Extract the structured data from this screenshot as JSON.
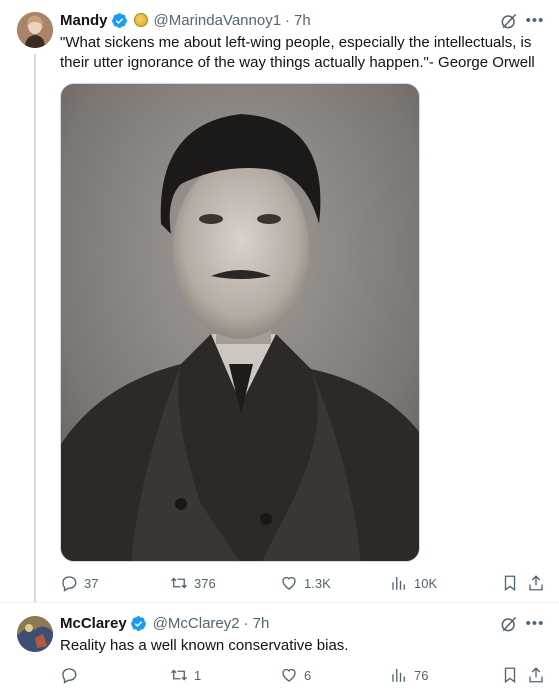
{
  "tweets": [
    {
      "author": {
        "name": "Mandy",
        "handle": "@MarindaVannoy1",
        "time": "7h"
      },
      "text": "\"What sickens me about left-wing people, especially the intellectuals, is their utter ignorance of the way things actually happen.\"- George Orwell",
      "stats": {
        "replies": "37",
        "reposts": "376",
        "likes": "1.3K",
        "views": "10K"
      }
    },
    {
      "author": {
        "name": "McClarey",
        "handle": "@McClarey2",
        "time": "7h"
      },
      "text": "Reality has a well known conservative bias.",
      "stats": {
        "replies": "",
        "reposts": "1",
        "likes": "6",
        "views": "76"
      }
    }
  ],
  "separator": "·",
  "colors": {
    "verified": "#1d9bf0",
    "text_secondary": "#536471",
    "text_primary": "#0f1419",
    "divider": "#eff3f4"
  },
  "icons": [
    "verified-icon",
    "grok-icon",
    "more-icon",
    "reply-icon",
    "repost-icon",
    "like-icon",
    "views-icon",
    "bookmark-icon",
    "share-icon"
  ]
}
